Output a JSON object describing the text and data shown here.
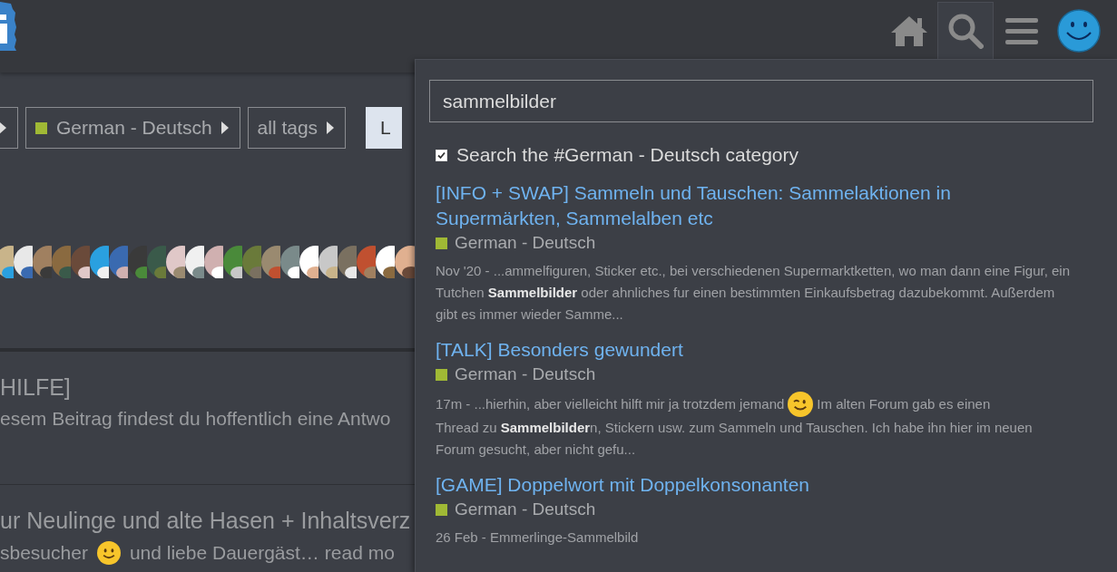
{
  "header": {
    "nav": [
      {
        "kind": "home",
        "selected": false
      },
      {
        "kind": "search",
        "selected": true
      },
      {
        "kind": "menu",
        "selected": false
      }
    ]
  },
  "breadcrumbs": [
    {
      "kind": "caret"
    },
    {
      "label": "German - Deutsch",
      "color": "#a0b935"
    },
    {
      "label": "all tags"
    }
  ],
  "breadcrumb_button": "L",
  "topics": [
    {
      "title": "HILFE]",
      "excerpt": "esem Beitrag findest du hoffentlich eine Antwo"
    },
    {
      "title": "ur Neulinge und alte Hasen + Inhaltsverz",
      "excerpt": "sbesucher",
      "excerpt_after": "und liebe Dauergäst…",
      "link": "read mo"
    }
  ],
  "search": {
    "value": "sammelbilder",
    "scope": {
      "label": "Search the #German - Deutsch category",
      "checked": true
    },
    "results": [
      {
        "title": "[INFO + SWAP] Sammeln und Tauschen: Sammelaktionen in Supermärkten, Sammelalben etc",
        "category": "German - Deutsch",
        "color": "#a0b935",
        "excerpt": [
          [
            {
              "text": "Nov '20 - ...ammelfiguren, Sticker etc., bei verschiedenen Supermarktketten, wo man dann eine Figur, ein Tutchen **Sammelbilder** oder ahnliches fur einen bestimmten Einkaufsbetrag dazubekommt. Außerdem gibt es immer wieder Samme..."
            }
          ]
        ]
      },
      {
        "title": "[TALK] Besonders gewundert",
        "category": "German - Deutsch",
        "color": "#a0b935",
        "excerpt": [
          [
            {
              "text": "17m - ...hierhin, aber vielleicht hilft mir ja trotzdem jemand"
            },
            {
              "kind": "wink"
            },
            {
              "text": "Im alten Forum gab es einen"
            }
          ],
          [
            {
              "text": "Thread zu **Sammelbilder**n, Stickern usw. zum Sammeln und Tauschen. Ich habe ihn hier im neuen Forum gesucht, aber nicht gefu..."
            }
          ]
        ]
      },
      {
        "title": "[GAME] Doppelwort mit Doppelkonsonanten",
        "category": "German - Deutsch",
        "color": "#a0b935",
        "excerpt": [
          [
            {
              "text": "26 Feb - Emmerlinge-Sammelbild"
            }
          ]
        ]
      }
    ]
  }
}
